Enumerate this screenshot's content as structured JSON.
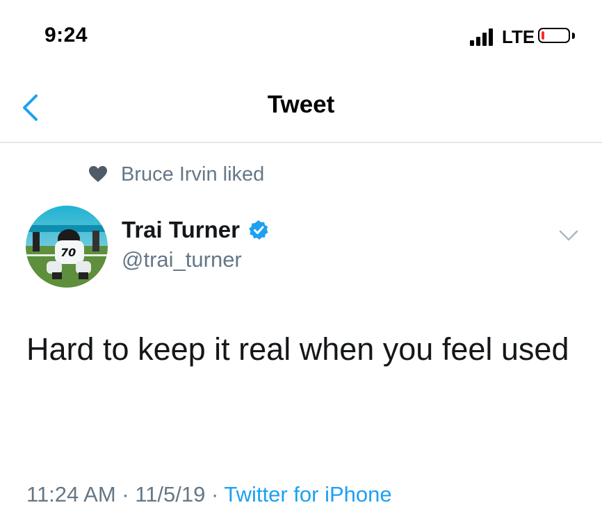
{
  "status_bar": {
    "time": "9:24",
    "network": "LTE",
    "battery_level": 0.08,
    "battery_color": "#ff2a2a"
  },
  "nav": {
    "title": "Tweet",
    "back_icon": "chevron-left-icon",
    "accent_color": "#1da1f2"
  },
  "social_context": {
    "icon": "heart-icon",
    "text": "Bruce Irvin liked"
  },
  "author": {
    "display_name": "Trai Turner",
    "verified": true,
    "handle": "@trai_turner",
    "avatar_jersey_number": "70"
  },
  "tweet": {
    "text": "Hard to keep it real when you feel used"
  },
  "meta": {
    "time": "11:24 AM",
    "separator1": " · ",
    "date": "11/5/19",
    "separator2": " · ",
    "client": "Twitter for iPhone"
  }
}
